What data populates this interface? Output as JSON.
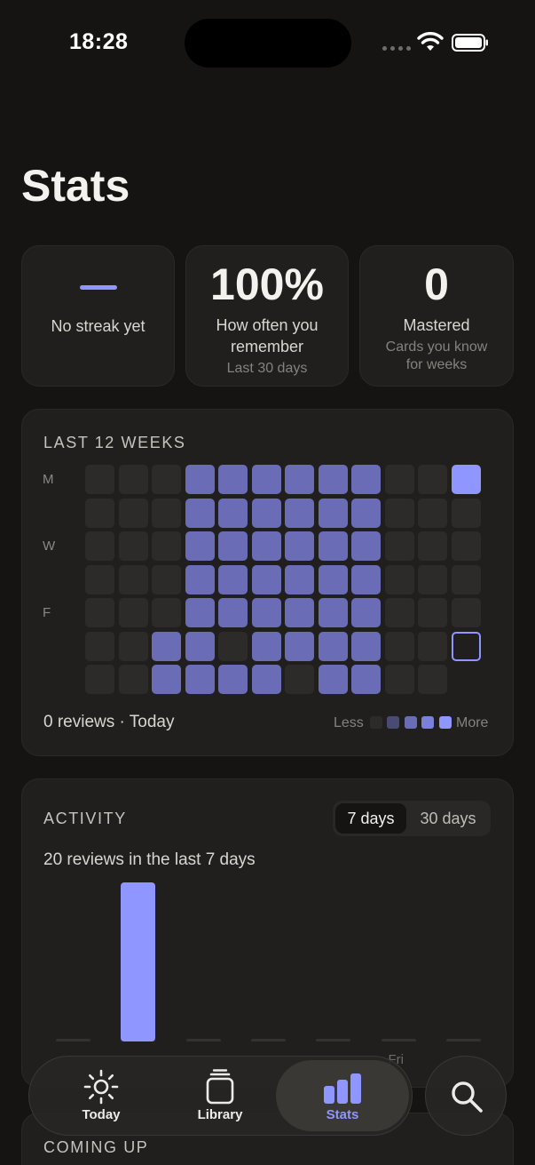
{
  "status_bar": {
    "time": "18:28"
  },
  "page_title": "Stats",
  "stats": {
    "streak": {
      "value": "—",
      "label": "No streak yet"
    },
    "retention": {
      "value": "100%",
      "label_line1": "How often you",
      "label_line2": "remember",
      "sub": "Last 30 days"
    },
    "mastered": {
      "value": "0",
      "label": "Mastered",
      "sub_line1": "Cards you know",
      "sub_line2": "for weeks"
    }
  },
  "heatmap": {
    "title": "LAST 12 WEEKS",
    "day_labels": [
      "M",
      "W",
      "F"
    ],
    "levels": [
      [
        0,
        0,
        0,
        2,
        2,
        2,
        2,
        2,
        2,
        0,
        0,
        4
      ],
      [
        0,
        0,
        0,
        2,
        2,
        2,
        2,
        2,
        2,
        0,
        0,
        0
      ],
      [
        0,
        0,
        0,
        2,
        2,
        2,
        2,
        2,
        2,
        0,
        0,
        0
      ],
      [
        0,
        0,
        0,
        2,
        2,
        2,
        2,
        2,
        2,
        0,
        0,
        0
      ],
      [
        0,
        0,
        0,
        2,
        2,
        2,
        2,
        2,
        2,
        0,
        0,
        0
      ],
      [
        0,
        0,
        2,
        2,
        0,
        2,
        2,
        2,
        2,
        0,
        0,
        -1
      ],
      [
        0,
        0,
        2,
        2,
        2,
        2,
        0,
        2,
        2,
        0,
        0,
        -2
      ]
    ],
    "today_row": 5,
    "footer": "0 reviews · Today",
    "legend_less": "Less",
    "legend_more": "More",
    "colors": {
      "empty": "#2d2b29",
      "level1": "#4b4a72",
      "level2": "#6a6db5",
      "level3": "#7b80d8",
      "level4": "#8f96ff",
      "today_outline": "#8f96ff"
    }
  },
  "activity": {
    "title": "ACTIVITY",
    "toggle": {
      "options": [
        "7 days",
        "30 days"
      ],
      "selected": "7 days"
    },
    "summary": "20 reviews in the last 7 days",
    "visible_day_label": "Fri",
    "bar_color": "#8f96ff"
  },
  "chart_data": {
    "type": "bar",
    "categories": [
      "",
      "",
      "",
      "",
      "",
      "Fri",
      ""
    ],
    "values": [
      0,
      20,
      0,
      0,
      0,
      0,
      0
    ],
    "title": "ACTIVITY",
    "xlabel": "",
    "ylabel": ""
  },
  "coming_up": {
    "title": "COMING UP"
  },
  "tab_bar": {
    "tabs": [
      {
        "label": "Today",
        "icon": "sun-icon"
      },
      {
        "label": "Library",
        "icon": "stack-icon"
      },
      {
        "label": "Stats",
        "icon": "bar-chart-icon"
      }
    ],
    "active": "Stats",
    "search_icon": "search-icon"
  },
  "accent_color": "#8f96ff"
}
